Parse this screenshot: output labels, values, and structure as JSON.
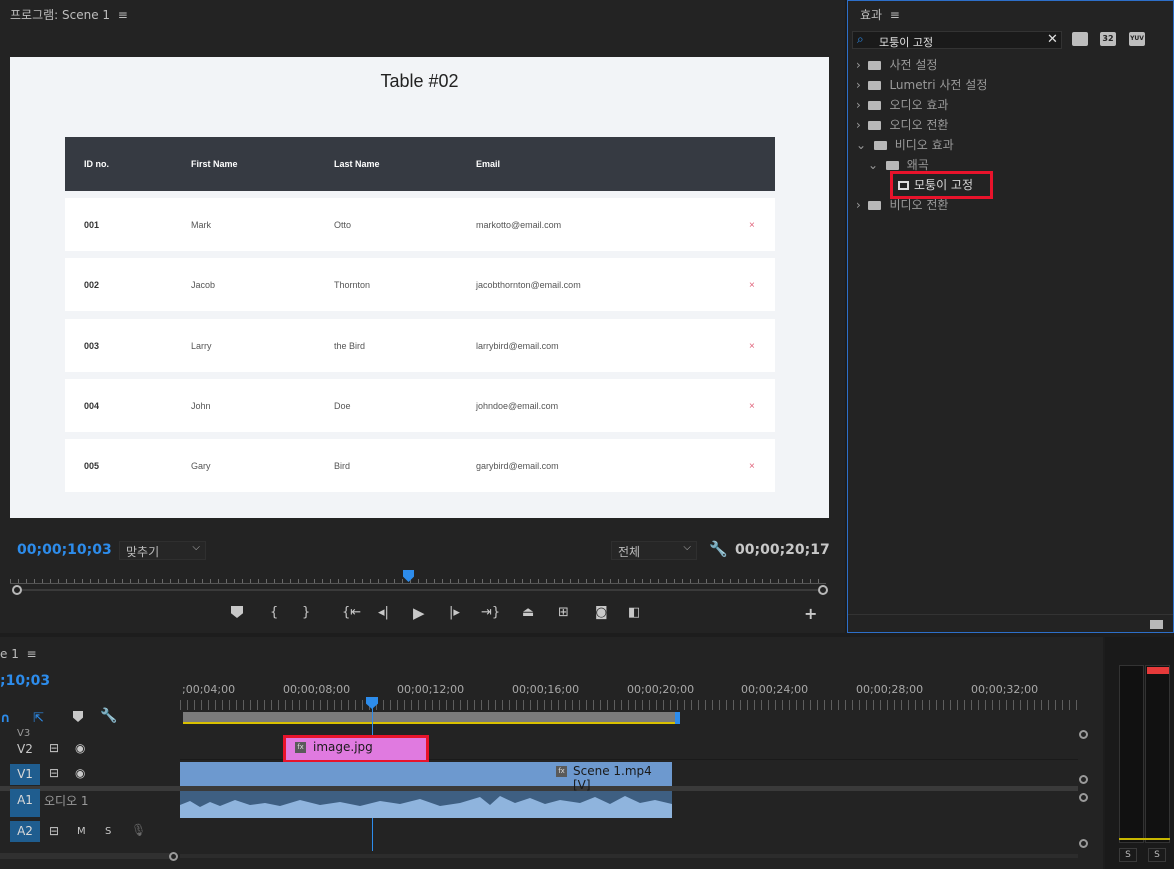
{
  "program": {
    "title": "프로그램: Scene 1",
    "menu_icon": "≡",
    "timecode_current": "00;00;10;03",
    "fit_select": "맞추기",
    "quality_select": "전체",
    "timecode_duration": "00;00;20;17",
    "video": {
      "title": "Table #02",
      "headers": [
        "ID no.",
        "First Name",
        "Last Name",
        "Email"
      ],
      "rows": [
        {
          "id": "001",
          "first": "Mark",
          "last": "Otto",
          "email": "markotto@email.com"
        },
        {
          "id": "002",
          "first": "Jacob",
          "last": "Thornton",
          "email": "jacobthornton@email.com"
        },
        {
          "id": "003",
          "first": "Larry",
          "last": "the Bird",
          "email": "larrybird@email.com"
        },
        {
          "id": "004",
          "first": "John",
          "last": "Doe",
          "email": "johndoe@email.com"
        },
        {
          "id": "005",
          "first": "Gary",
          "last": "Bird",
          "email": "garybird@email.com"
        }
      ],
      "remove_glyph": "×"
    },
    "transport": [
      "marker-icon",
      "mark-in-icon",
      "mark-out-icon",
      "go-to-in-icon",
      "step-back-icon",
      "play-icon",
      "step-forward-icon",
      "go-to-out-icon",
      "lift-icon",
      "extract-icon",
      "export-frame-icon",
      "compare-icon",
      "add-button-icon"
    ],
    "add_glyph": "+"
  },
  "effects": {
    "title": "효과",
    "menu_icon": "≡",
    "search_value": "모퉁이 고정",
    "badges": [
      "32",
      "YUV"
    ],
    "tree": {
      "presets": "사전 설정",
      "lumetri": "Lumetri 사전 설정",
      "audio_effects": "오디오 효과",
      "audio_transitions": "오디오 전환",
      "video_effects": "비디오 효과",
      "distort": "왜곡",
      "corner_pin": "모퉁이 고정",
      "video_transitions": "비디오 전환"
    }
  },
  "timeline": {
    "title": "e 1",
    "menu_icon": "≡",
    "timecode": ";10;03",
    "ruler": [
      ";00;04;00",
      "00;00;08;00",
      "00;00;12;00",
      "00;00;16;00",
      "00;00;20;00",
      "00;00;24;00",
      "00;00;28;00",
      "00;00;32;00"
    ],
    "tracks": {
      "v3": "V3",
      "v2": "V2",
      "v1": "V1",
      "a1": "A1",
      "a1_name": "오디오 1",
      "a2": "A2",
      "mute": "M",
      "solo": "S"
    },
    "clips": {
      "image": "image.jpg",
      "scene": "Scene 1.mp4 [V]",
      "fx_badge": "fx"
    }
  },
  "meters": {
    "solo_left": "S",
    "solo_right": "S"
  },
  "colors": {
    "accent_blue": "#2d8ceb",
    "highlight_red": "#e8132b",
    "image_clip": "#e07ae0",
    "video_clip": "#6d99cf",
    "audio_clip": "#3e5f82"
  }
}
